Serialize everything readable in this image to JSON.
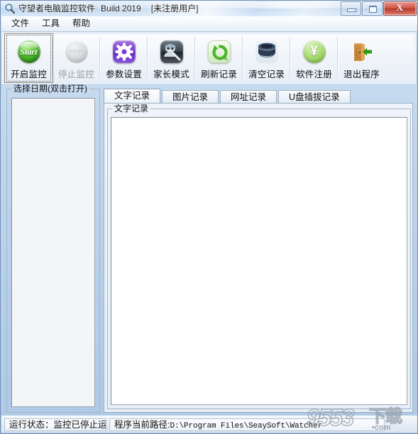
{
  "window": {
    "title_main": "守望者电脑监控软件",
    "title_build": "Build 2019",
    "title_registration": "[未注册用户]",
    "icon": "magnifier-app-icon",
    "controls": {
      "minimize": "minimize-icon",
      "maximize": "maximize-icon",
      "close": "X"
    }
  },
  "menubar": {
    "items": [
      {
        "label": "文件"
      },
      {
        "label": "工具"
      },
      {
        "label": "帮助"
      }
    ]
  },
  "toolbar": {
    "buttons": [
      {
        "label": "开启监控",
        "icon": "start-green-button-icon",
        "icon_text": "Start",
        "disabled": false,
        "focused": true
      },
      {
        "label": "停止监控",
        "icon": "stop-grey-button-icon",
        "icon_text": "stop",
        "disabled": true,
        "focused": false
      },
      {
        "label": "参数设置",
        "icon": "gear-settings-icon",
        "icon_text": "",
        "disabled": false,
        "focused": false
      },
      {
        "label": "家长模式",
        "icon": "parent-mode-icon",
        "icon_text": "",
        "disabled": false,
        "focused": false
      },
      {
        "label": "刷新记录",
        "icon": "refresh-circular-arrows-icon",
        "icon_text": "",
        "disabled": false,
        "focused": false
      },
      {
        "label": "清空记录",
        "icon": "trash-bin-icon",
        "icon_text": "",
        "disabled": false,
        "focused": false
      },
      {
        "label": "软件注册",
        "icon": "yen-coin-register-icon",
        "icon_text": "¥",
        "disabled": false,
        "focused": false
      },
      {
        "label": "退出程序",
        "icon": "exit-door-arrow-icon",
        "icon_text": "",
        "disabled": false,
        "focused": false
      }
    ]
  },
  "left_panel": {
    "group_title": "选择日期(双击打开)",
    "list_items": []
  },
  "tabs": [
    {
      "label": "文字记录",
      "active": true
    },
    {
      "label": "图片记录",
      "active": false
    },
    {
      "label": "网址记录",
      "active": false
    },
    {
      "label": "U盘插拔记录",
      "active": false
    }
  ],
  "content": {
    "group_title": "文字记录",
    "text_value": "",
    "scrollbar": {
      "up_icon": "scroll-up-arrow-icon",
      "down_icon": "scroll-down-arrow-icon"
    }
  },
  "statusbar": {
    "run_status": "运行状态：监控已停止运行",
    "path_label": "程序当前路径:",
    "path_value": "D:\\Program Files\\SeaySoft\\Watcher"
  },
  "watermark": {
    "digits": "9553",
    "cn": "下载",
    "domain": "•com"
  },
  "colors": {
    "accent_blue": "#aec9e6",
    "title_gradient_top": "#e9f2fb",
    "close_red": "#d1564a",
    "start_green": "#57c134",
    "gear_purple": "#7b3fd0",
    "field_white": "#ffffff"
  }
}
